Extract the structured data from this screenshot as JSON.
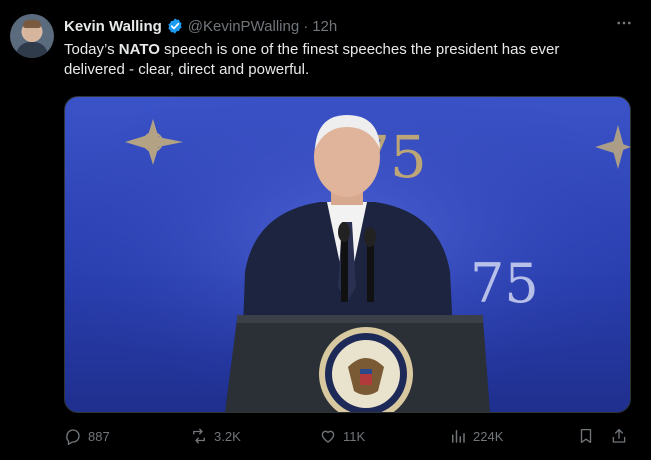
{
  "author": {
    "name": "Kevin Walling",
    "handle": "@KevinPWalling",
    "separator": "·",
    "time": "12h"
  },
  "tweet": {
    "text_before": "Today’s ",
    "text_bold": "NATO",
    "text_after": " speech is one of the finest speeches the president has ever delivered - clear, direct and powerful."
  },
  "media": {
    "backdrop_text": "75"
  },
  "metrics": {
    "replies": "887",
    "reposts": "3.2K",
    "likes": "11K",
    "views": "224K"
  },
  "colors": {
    "background": "#000000",
    "text": "#e7e9ea",
    "muted": "#71767b",
    "verified": "#1d9bf0"
  },
  "icons": [
    "verified-badge-icon",
    "more-icon",
    "reply-icon",
    "repost-icon",
    "like-icon",
    "views-icon",
    "bookmark-icon",
    "share-icon"
  ]
}
